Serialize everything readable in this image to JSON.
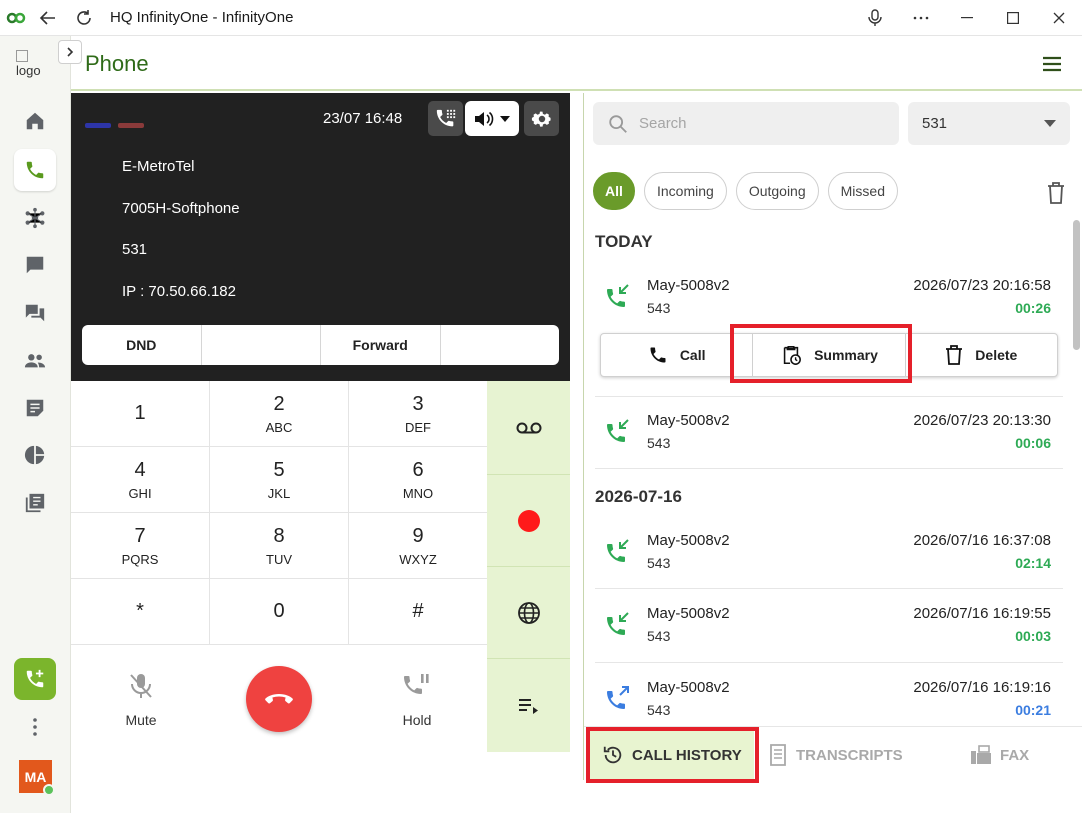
{
  "window": {
    "title": "HQ InfinityOne - InfinityOne"
  },
  "sidebar": {
    "logo_alt": "logo",
    "avatar_initials": "MA"
  },
  "header": {
    "title": "Phone"
  },
  "phone": {
    "datetime": "23/07  16:48",
    "info": [
      "E-MetroTel",
      "7005H-Softphone",
      "531",
      "IP : 70.50.66.182"
    ],
    "soft_keys": [
      "DND",
      "",
      "Forward",
      ""
    ],
    "keys": [
      {
        "num": "1",
        "letters": ""
      },
      {
        "num": "2",
        "letters": "ABC"
      },
      {
        "num": "3",
        "letters": "DEF"
      },
      {
        "num": "4",
        "letters": "GHI"
      },
      {
        "num": "5",
        "letters": "JKL"
      },
      {
        "num": "6",
        "letters": "MNO"
      },
      {
        "num": "7",
        "letters": "PQRS"
      },
      {
        "num": "8",
        "letters": "TUV"
      },
      {
        "num": "9",
        "letters": "WXYZ"
      },
      {
        "num": "*",
        "letters": ""
      },
      {
        "num": "0",
        "letters": ""
      },
      {
        "num": "#",
        "letters": ""
      }
    ],
    "mute_label": "Mute",
    "hold_label": "Hold",
    "colors": {
      "led1": "#2d35a8",
      "led2": "#8a3a3a",
      "record": "#ff1a1a",
      "hangup": "#ef4240"
    }
  },
  "history": {
    "search_placeholder": "Search",
    "extension": "531",
    "filters": [
      "All",
      "Incoming",
      "Outgoing",
      "Missed"
    ],
    "groups": [
      "TODAY",
      "2026-07-16"
    ],
    "records": [
      {
        "name": "May-5008v2",
        "ext": "543",
        "date": "2026/07/23 20:16:58",
        "duration": "00:26",
        "direction": "incoming"
      },
      {
        "name": "May-5008v2",
        "ext": "543",
        "date": "2026/07/23 20:13:30",
        "duration": "00:06",
        "direction": "incoming"
      },
      {
        "name": "May-5008v2",
        "ext": "543",
        "date": "2026/07/16 16:37:08",
        "duration": "02:14",
        "direction": "incoming"
      },
      {
        "name": "May-5008v2",
        "ext": "543",
        "date": "2026/07/16 16:19:55",
        "duration": "00:03",
        "direction": "incoming"
      },
      {
        "name": "May-5008v2",
        "ext": "543",
        "date": "2026/07/16 16:19:16",
        "duration": "00:21",
        "direction": "outgoing"
      }
    ],
    "actions": {
      "call": "Call",
      "summary": "Summary",
      "delete": "Delete"
    },
    "tabs": {
      "history": "CALL HISTORY",
      "transcripts": "TRANSCRIPTS",
      "fax": "FAX"
    },
    "colors": {
      "incoming": "#2eaa55",
      "outgoing": "#3b7de0",
      "accent": "#6a9b2a",
      "highlight": "#e5202a"
    }
  }
}
